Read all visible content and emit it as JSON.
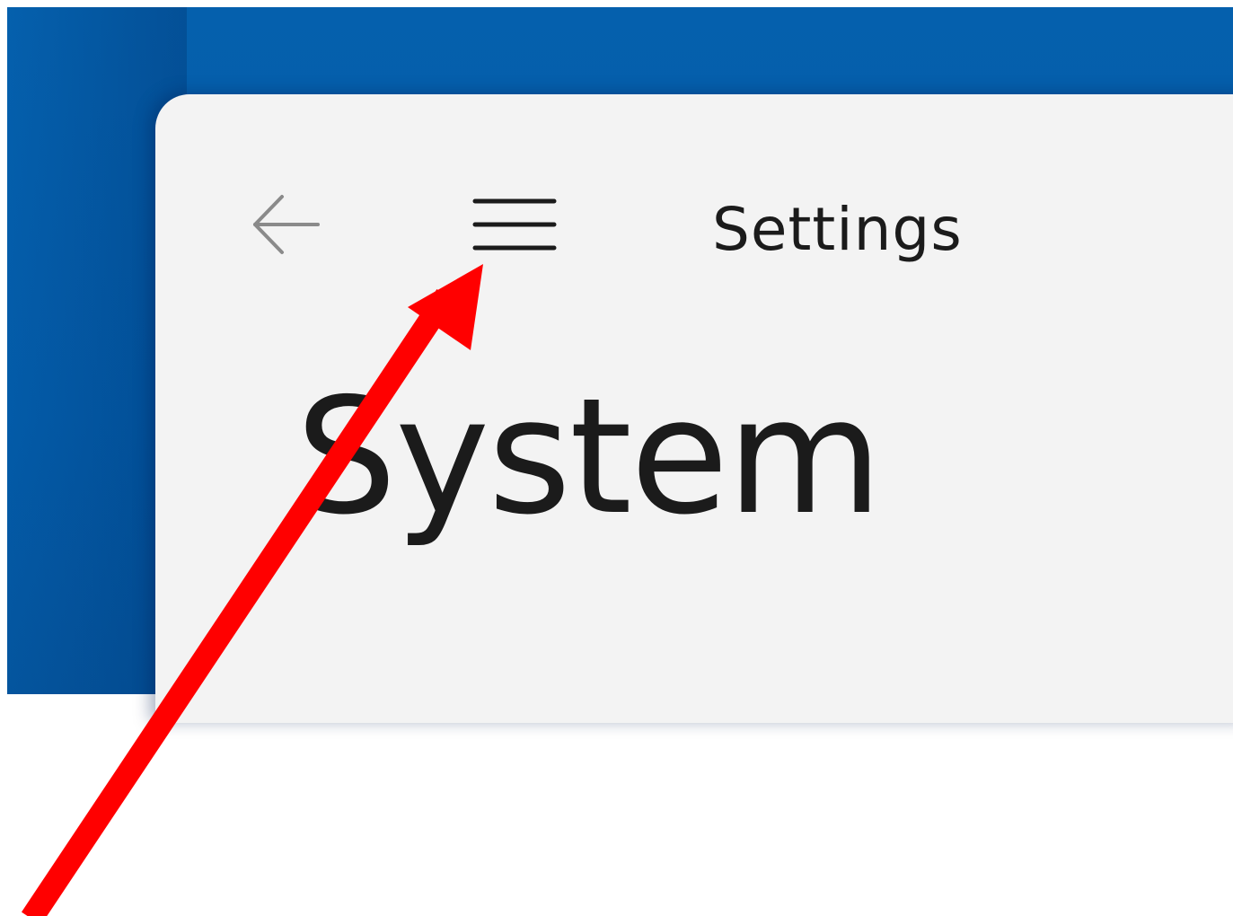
{
  "window": {
    "app_title": "Settings",
    "page_title": "System"
  },
  "toolbar": {
    "back_icon": "back-arrow-icon",
    "menu_icon": "hamburger-menu-icon"
  },
  "annotation": {
    "type": "red-arrow",
    "color": "#ff0000",
    "points_to": "menu-button"
  },
  "colors": {
    "desktop": "#035ba8",
    "window_bg": "#f3f3f3",
    "text": "#1b1b1b",
    "back_icon": "#8a8a8a"
  }
}
